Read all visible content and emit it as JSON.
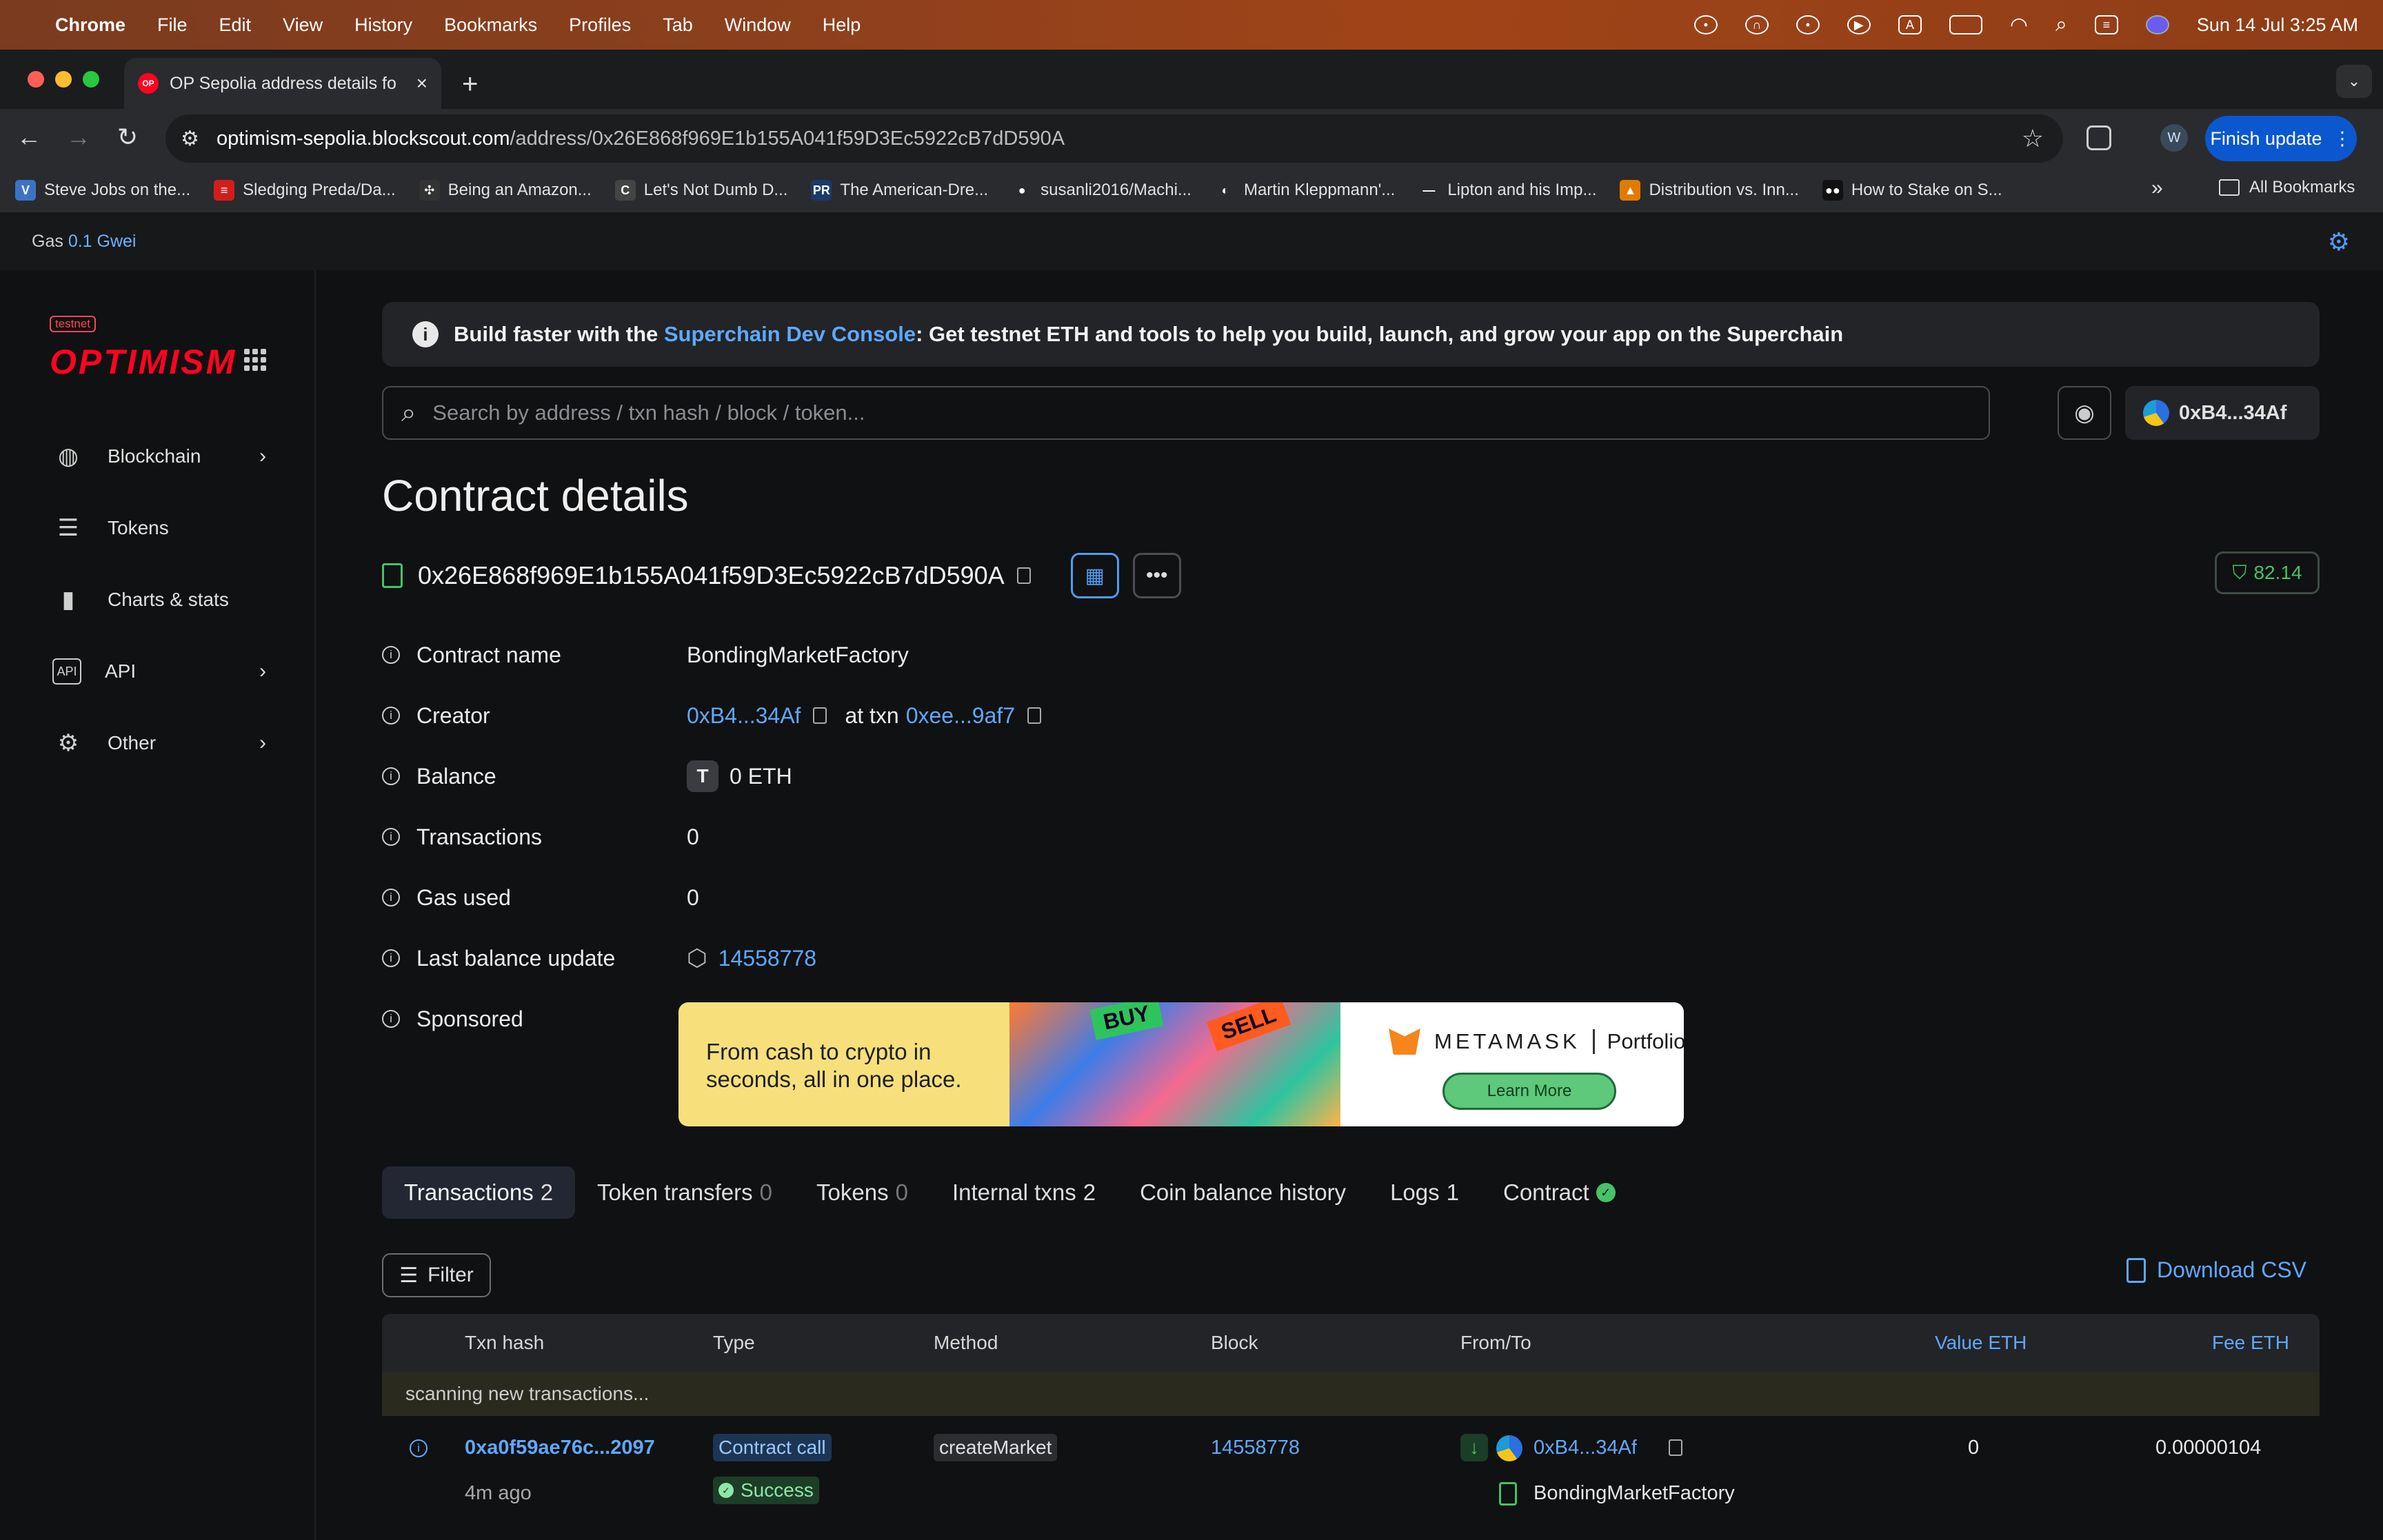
{
  "menubar": {
    "app": "Chrome",
    "items": [
      "File",
      "Edit",
      "View",
      "History",
      "Bookmarks",
      "Profiles",
      "Tab",
      "Window",
      "Help"
    ],
    "clock": "Sun 14 Jul  3:25 AM"
  },
  "tab": {
    "favicon": "OP",
    "title": "OP Sepolia address details fo"
  },
  "omnibox": {
    "host": "optimism-sepolia.blockscout.com",
    "path": "/address/0x26E868f969E1b155A041f59D3Ec5922cB7dD590A"
  },
  "toolbar": {
    "profile_initial": "W",
    "finish_update": "Finish update"
  },
  "bookmarks": [
    {
      "label": "Steve Jobs on the...",
      "icon": "V",
      "color": "#3b73c4"
    },
    {
      "label": "Sledging Preda/Da...",
      "icon": "≡",
      "color": "#d21d1d"
    },
    {
      "label": "Being an Amazon...",
      "icon": "✣",
      "color": "#333333"
    },
    {
      "label": "Let's Not Dumb D...",
      "icon": "C",
      "color": "#444444"
    },
    {
      "label": "The American-Dre...",
      "icon": "PR",
      "color": "#1a3a6b"
    },
    {
      "label": "susanli2016/Machi...",
      "icon": "●",
      "color": "#2a2b2e"
    },
    {
      "label": "Martin Kleppmann'...",
      "icon": "◐",
      "color": "#2a2b2e"
    },
    {
      "label": "Lipton and his Imp...",
      "icon": "—",
      "color": "#2a2b2e"
    },
    {
      "label": "Distribution vs. Inn...",
      "icon": "▲",
      "color": "#e07b00"
    },
    {
      "label": "How to Stake on S...",
      "icon": "●●",
      "color": "#111111"
    }
  ],
  "bookmarks_more": "»",
  "all_bookmarks": "All Bookmarks",
  "gas": {
    "label": "Gas",
    "value": "0.1 Gwei"
  },
  "sidebar": {
    "badge": "testnet",
    "logo": "OPTIMISM",
    "items": [
      {
        "label": "Blockchain",
        "icon": "globe-icon",
        "chevron": true
      },
      {
        "label": "Tokens",
        "icon": "coins-icon",
        "chevron": false
      },
      {
        "label": "Charts & stats",
        "icon": "chart-icon",
        "chevron": false
      },
      {
        "label": "API",
        "icon": "api-icon",
        "chevron": true
      },
      {
        "label": "Other",
        "icon": "gear-icon",
        "chevron": true
      }
    ]
  },
  "banner": {
    "prefix": "Build faster with the ",
    "link": "Superchain Dev Console",
    "suffix": ": Get testnet ETH and tools to help you build, launch, and grow your app on the Superchain"
  },
  "search": {
    "placeholder": "Search by address / txn hash / block / token..."
  },
  "wallet": {
    "address": "0xB4...34Af"
  },
  "page_title": "Contract details",
  "contract": {
    "address": "0x26E868f969E1b155A041f59D3Ec5922cB7dD590A",
    "score": "82.14"
  },
  "details": {
    "contract_name_label": "Contract name",
    "contract_name": "BondingMarketFactory",
    "creator_label": "Creator",
    "creator": "0xB4...34Af",
    "at_txn": "at txn",
    "creator_txn": "0xee...9af7",
    "balance_label": "Balance",
    "balance_token": "T",
    "balance": "0 ETH",
    "transactions_label": "Transactions",
    "transactions": "0",
    "gas_used_label": "Gas used",
    "gas_used": "0",
    "last_balance_label": "Last balance update",
    "last_balance_block": "14558778",
    "sponsored_label": "Sponsored"
  },
  "ad": {
    "line1": "From cash to crypto in",
    "line2": "seconds, all in one place.",
    "buy": "BUY",
    "sell": "SELL",
    "brand": "METAMASK",
    "product": "Portfolio",
    "cta": "Learn More"
  },
  "tabs": [
    {
      "label": "Transactions",
      "count": "2",
      "active": true
    },
    {
      "label": "Token transfers",
      "count": "0"
    },
    {
      "label": "Tokens",
      "count": "0"
    },
    {
      "label": "Internal txns",
      "count": "2"
    },
    {
      "label": "Coin balance history",
      "count": ""
    },
    {
      "label": "Logs",
      "count": "1"
    },
    {
      "label": "Contract",
      "count": ""
    }
  ],
  "filter_label": "Filter",
  "download_csv": "Download CSV",
  "table": {
    "headers": {
      "txn_hash": "Txn hash",
      "type": "Type",
      "method": "Method",
      "block": "Block",
      "from_to": "From/To",
      "value": "Value ETH",
      "fee": "Fee ETH"
    },
    "scanning": "scanning new transactions...",
    "rows": [
      {
        "hash": "0xa0f59ae76c...2097",
        "age": "4m ago",
        "type": "Contract call",
        "status": "Success",
        "method": "createMarket",
        "block": "14558778",
        "from": "0xB4...34Af",
        "to": "BondingMarketFactory",
        "value": "0",
        "fee": "0.00000104"
      }
    ]
  }
}
